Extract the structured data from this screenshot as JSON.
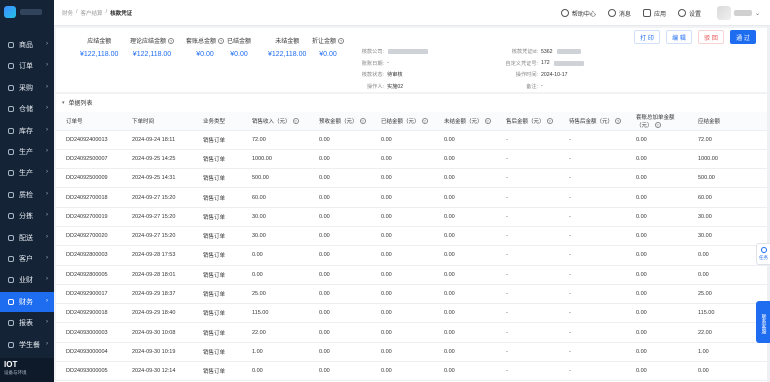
{
  "sidebar": {
    "items": [
      {
        "label": "商品",
        "active": false
      },
      {
        "label": "订单",
        "active": false
      },
      {
        "label": "采购",
        "active": false
      },
      {
        "label": "仓储",
        "active": false
      },
      {
        "label": "库存",
        "active": false
      },
      {
        "label": "生产",
        "active": false
      },
      {
        "label": "生产",
        "active": false
      },
      {
        "label": "质检",
        "active": false
      },
      {
        "label": "分拣",
        "active": false
      },
      {
        "label": "配送",
        "active": false
      },
      {
        "label": "客户",
        "active": false
      },
      {
        "label": "业财",
        "active": false
      },
      {
        "label": "财务",
        "active": true
      },
      {
        "label": "报表",
        "active": false
      },
      {
        "label": "学生餐",
        "active": false
      }
    ],
    "iot": {
      "title": "IOT",
      "subtitle": "设备与环境"
    }
  },
  "header": {
    "breadcrumb": [
      "财务",
      "客户结算",
      "核款凭证"
    ],
    "help": "帮助中心",
    "messages": "消息",
    "apps": "应用",
    "settings": "设置"
  },
  "summary": {
    "stats": [
      {
        "label": "应结金额",
        "value": "¥122,118.00",
        "help": false
      },
      {
        "label": "理论应结金额",
        "value": "¥122,118.00",
        "help": true
      },
      {
        "label": "套账总金额",
        "value": "¥0.00",
        "help": true
      },
      {
        "label": "已结金额",
        "value": "¥0.00",
        "help": false
      },
      {
        "label": "未结金额",
        "value": "¥122,118.00",
        "help": false
      },
      {
        "label": "折让金额",
        "value": "¥0.00",
        "help": true
      }
    ],
    "info_left": [
      {
        "label": "核款公司:",
        "value": ""
      },
      {
        "label": "账账日期:",
        "value": "-"
      },
      {
        "label": "核款状态:",
        "value": "待审核"
      },
      {
        "label": "操作人:",
        "value": "实施02"
      }
    ],
    "info_right": [
      {
        "label": "核款凭证id:",
        "value": "5362"
      },
      {
        "label": "自定义凭证号:",
        "value": "172"
      },
      {
        "label": "操作时间:",
        "value": "2024-10-17"
      },
      {
        "label": "备注:",
        "value": "-"
      }
    ],
    "actions": {
      "print": "打 印",
      "edit": "编 辑",
      "delete": "驳 回",
      "approve": "通 过"
    }
  },
  "section": {
    "title": "单据列表",
    "columns": [
      {
        "label": "订单号",
        "help": false
      },
      {
        "label": "下单时间",
        "help": false
      },
      {
        "label": "业务类型",
        "help": false
      },
      {
        "label": "销售收入（元）",
        "help": true
      },
      {
        "label": "预收金额（元）",
        "help": true
      },
      {
        "label": "已结金额（元）",
        "help": true
      },
      {
        "label": "未结金额（元）",
        "help": true
      },
      {
        "label": "售后金额（元）",
        "help": true
      },
      {
        "label": "待售后金额（元）",
        "help": true
      },
      {
        "label": "套账总加单金额（元）",
        "help": true
      },
      {
        "label": "应结金额",
        "help": false
      }
    ],
    "rows": [
      [
        "DD24092400013",
        "2024-09-24 18:11",
        "销售订单",
        "72.00",
        "0.00",
        "0.00",
        "0.00",
        "-",
        "-",
        "0.00",
        "72.00"
      ],
      [
        "DD24092500007",
        "2024-09-25 14:25",
        "销售订单",
        "1000.00",
        "0.00",
        "0.00",
        "0.00",
        "-",
        "-",
        "0.00",
        "1000.00"
      ],
      [
        "DD24092500009",
        "2024-09-25 14:31",
        "销售订单",
        "500.00",
        "0.00",
        "0.00",
        "0.00",
        "-",
        "-",
        "0.00",
        "500.00"
      ],
      [
        "DD24092700018",
        "2024-09-27 15:20",
        "销售订单",
        "60.00",
        "0.00",
        "0.00",
        "0.00",
        "-",
        "-",
        "0.00",
        "60.00"
      ],
      [
        "DD24092700019",
        "2024-09-27 15:20",
        "销售订单",
        "30.00",
        "0.00",
        "0.00",
        "0.00",
        "-",
        "-",
        "0.00",
        "30.00"
      ],
      [
        "DD24092700020",
        "2024-09-27 15:20",
        "销售订单",
        "30.00",
        "0.00",
        "0.00",
        "0.00",
        "-",
        "-",
        "0.00",
        "30.00"
      ],
      [
        "DD24092800003",
        "2024-09-28 17:53",
        "销售订单",
        "0.00",
        "0.00",
        "0.00",
        "0.00",
        "-",
        "-",
        "0.00",
        "0.00"
      ],
      [
        "DD24092800005",
        "2024-09-28 18:01",
        "销售订单",
        "0.00",
        "0.00",
        "0.00",
        "0.00",
        "-",
        "-",
        "0.00",
        "0.00"
      ],
      [
        "DD24092900017",
        "2024-09-29 18:37",
        "销售订单",
        "25.00",
        "0.00",
        "0.00",
        "0.00",
        "-",
        "-",
        "0.00",
        "25.00"
      ],
      [
        "DD24092900018",
        "2024-09-29 18:40",
        "销售订单",
        "115.00",
        "0.00",
        "0.00",
        "0.00",
        "-",
        "-",
        "0.00",
        "115.00"
      ],
      [
        "DD24093000003",
        "2024-09-30 10:08",
        "销售订单",
        "22.00",
        "0.00",
        "0.00",
        "0.00",
        "-",
        "-",
        "0.00",
        "22.00"
      ],
      [
        "DD24093000004",
        "2024-09-30 10:19",
        "销售订单",
        "1.00",
        "0.00",
        "0.00",
        "0.00",
        "-",
        "-",
        "0.00",
        "1.00"
      ],
      [
        "DD24093000005",
        "2024-09-30 12:14",
        "销售订单",
        "0.00",
        "0.00",
        "0.00",
        "0.00",
        "-",
        "-",
        "0.00",
        "0.00"
      ]
    ]
  },
  "floating": {
    "task": "任务",
    "contact": "联系客服"
  },
  "colors": {
    "sidebar_bg": "#142336",
    "accent": "#1e6cf0",
    "danger": "#e84a4a"
  }
}
